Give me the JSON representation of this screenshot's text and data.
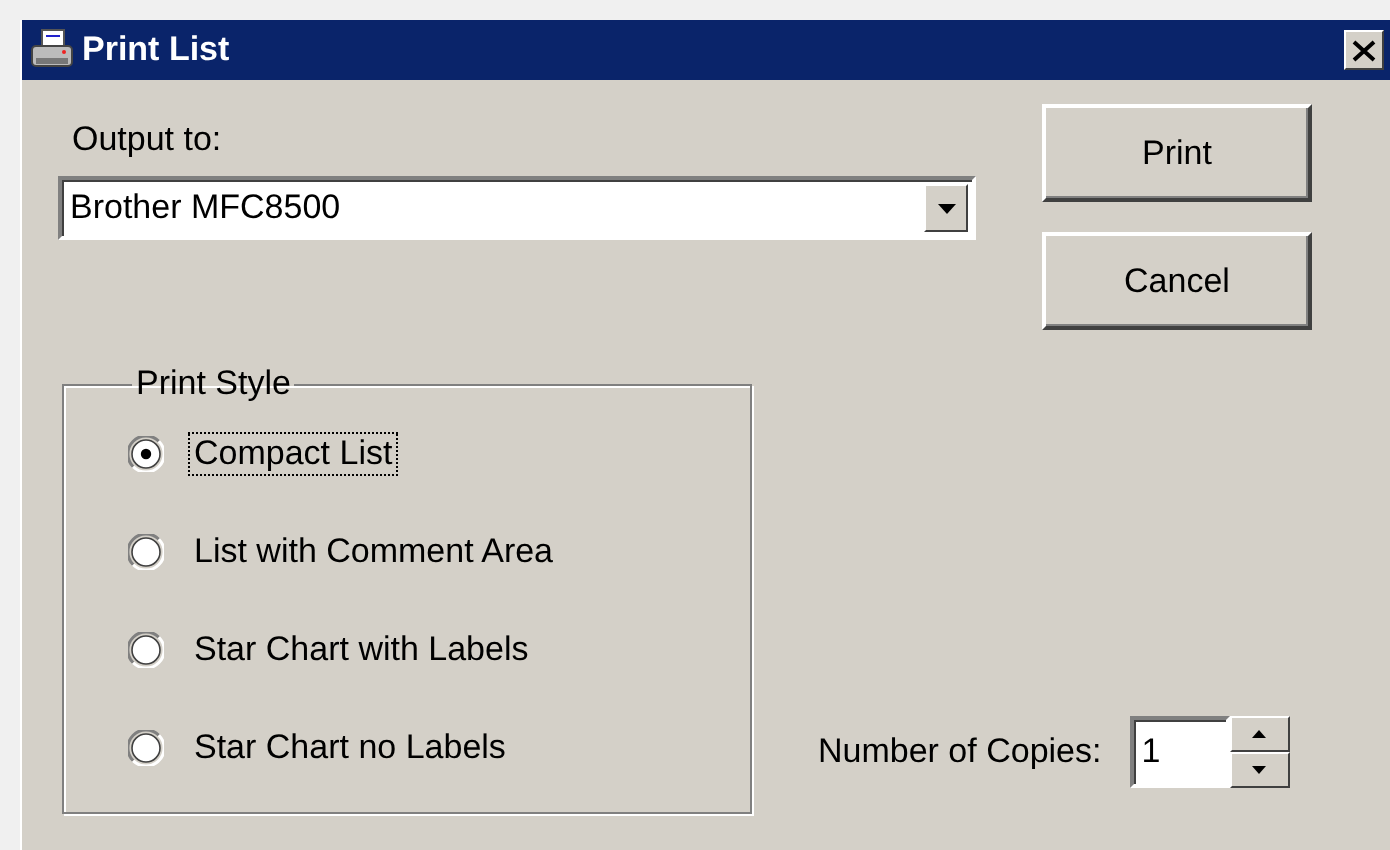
{
  "window": {
    "title": "Print List"
  },
  "output": {
    "label": "Output to:",
    "value": "Brother MFC8500"
  },
  "buttons": [
    "Print",
    "Cancel"
  ],
  "print_style": {
    "title": "Print Style",
    "options": [
      {
        "label": "Compact List",
        "selected": true
      },
      {
        "label": "List with Comment Area",
        "selected": false
      },
      {
        "label": "Star Chart with Labels",
        "selected": false
      },
      {
        "label": "Star Chart no Labels",
        "selected": false
      }
    ]
  },
  "copies": {
    "label": "Number of Copies:",
    "value": "1"
  }
}
